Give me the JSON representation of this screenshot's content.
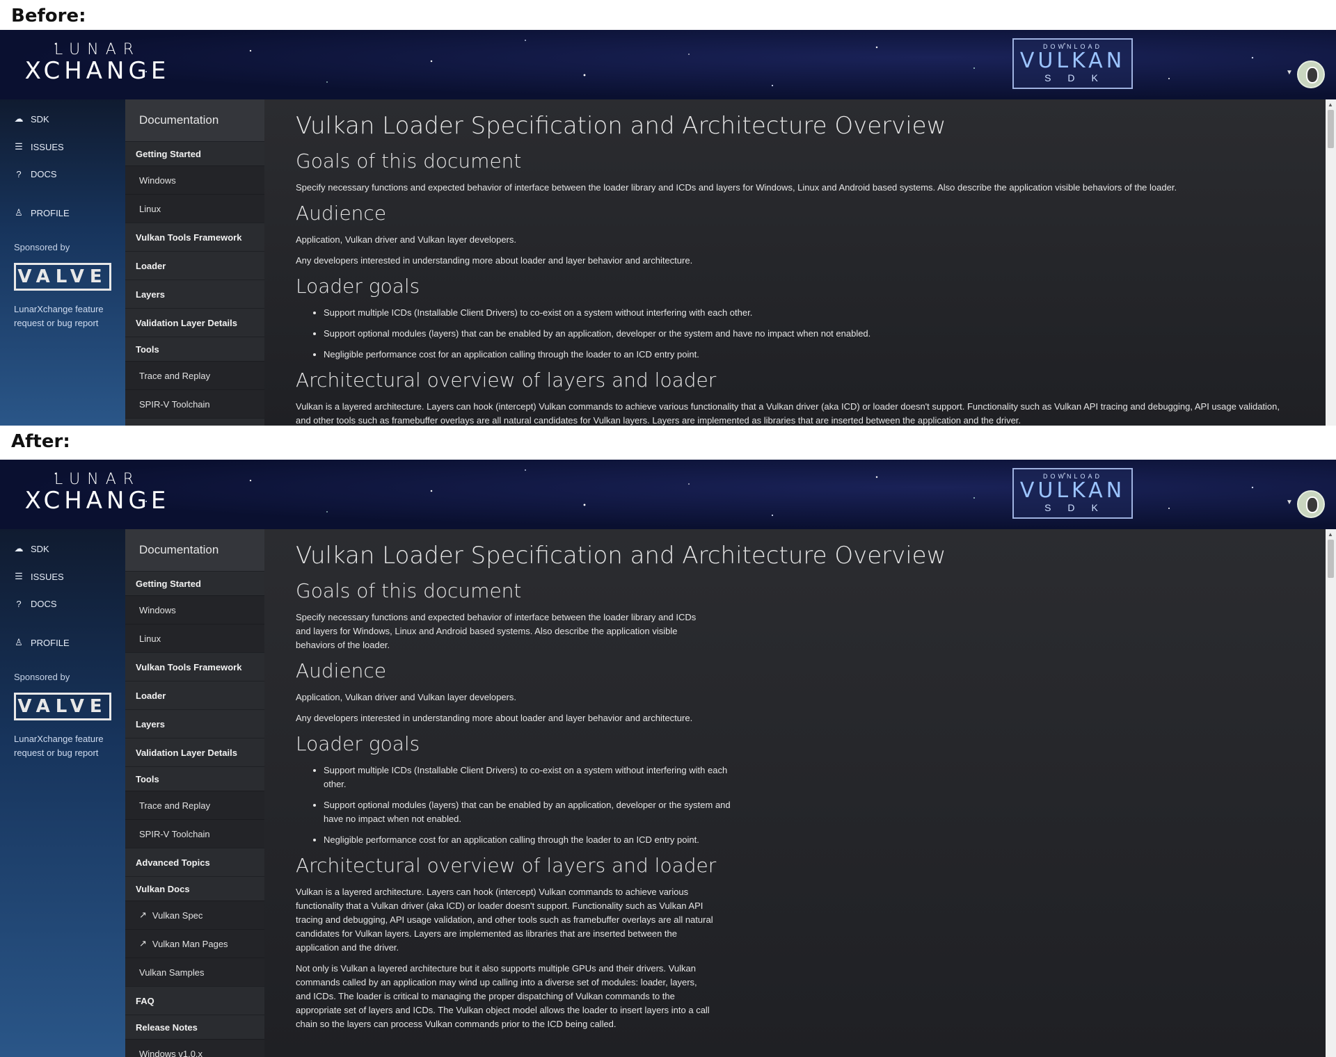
{
  "captions": {
    "before": "Before:",
    "after": "After:"
  },
  "header": {
    "logo_top": "LUNAR",
    "logo_bottom": "XCHANGE",
    "sdk_download": "DOWNLOAD",
    "sdk_name": "VULKAN",
    "sdk_sub": "SDK"
  },
  "leftnav": {
    "items": [
      {
        "icon": "cloud-download-icon",
        "label": "SDK"
      },
      {
        "icon": "list-icon",
        "label": "ISSUES"
      },
      {
        "icon": "help-circle-icon",
        "label": "DOCS"
      },
      {
        "icon": "user-icon",
        "label": "PROFILE"
      }
    ],
    "sponsored_by": "Sponsored by",
    "sponsor_logo": "VALVE",
    "feature_link": "LunarXchange feature request or bug report"
  },
  "docnav": {
    "title": "Documentation",
    "sections": [
      {
        "type": "sec",
        "label": "Getting Started"
      },
      {
        "type": "sub",
        "label": "Windows"
      },
      {
        "type": "sub",
        "label": "Linux"
      },
      {
        "type": "sec",
        "label": "Vulkan Tools Framework"
      },
      {
        "type": "sec",
        "label": "Loader"
      },
      {
        "type": "sec",
        "label": "Layers"
      },
      {
        "type": "sec",
        "label": "Validation Layer Details"
      },
      {
        "type": "sec",
        "label": "Tools"
      },
      {
        "type": "sub",
        "label": "Trace and Replay"
      },
      {
        "type": "sub",
        "label": "SPIR-V Toolchain"
      },
      {
        "type": "sec",
        "label": "Advanced Topics"
      },
      {
        "type": "sec",
        "label": "Vulkan Docs"
      },
      {
        "type": "sub",
        "label": "Vulkan Spec"
      },
      {
        "type": "sub",
        "label": "Vulkan Man Pages"
      },
      {
        "type": "sub",
        "label": "Vulkan Samples"
      },
      {
        "type": "sec",
        "label": "FAQ"
      },
      {
        "type": "sec",
        "label": "Release Notes"
      },
      {
        "type": "sub",
        "label": "Windows v1.0.x"
      }
    ]
  },
  "content": {
    "title": "Vulkan Loader Specification and Architecture Overview",
    "goals_heading": "Goals of this document",
    "goals_text": "Specify necessary functions and expected behavior of interface between the loader library and ICDs and layers for Windows, Linux and Android based systems. Also describe the application visible behaviors of the loader.",
    "audience_heading": "Audience",
    "audience_p1": "Application, Vulkan driver and Vulkan layer developers.",
    "audience_p2": "Any developers interested in understanding more about loader and layer behavior and architecture.",
    "loader_goals_heading": "Loader goals",
    "loader_goals": [
      "Support multiple ICDs (Installable Client Drivers) to co-exist on a system without interfering with each other.",
      "Support optional modules (layers) that can be enabled by an application, developer or the system and have no impact when not enabled.",
      "Negligible performance cost for an application calling through the loader to an ICD entry point."
    ],
    "arch_heading": "Architectural overview of layers and loader",
    "arch_p1": "Vulkan is a layered architecture. Layers can hook (intercept) Vulkan commands to achieve various functionality that a Vulkan driver (aka ICD) or loader doesn't support. Functionality such as Vulkan API tracing and debugging, API usage validation, and other tools such as framebuffer overlays are all natural candidates for Vulkan layers. Layers are implemented as libraries that are inserted between the application and the driver.",
    "arch_p2": "Not only is Vulkan a layered architecture but it also supports multiple GPUs and their drivers. Vulkan commands called by an application may wind up calling into a diverse set of modules: loader, layers, and ICDs. The loader is critical to managing the proper dispatching of Vulkan commands to the appropriate set of layers and ICDs. The Vulkan object model allows the loader to insert layers into a call chain so the layers can process Vulkan commands prior to the ICD being called."
  }
}
